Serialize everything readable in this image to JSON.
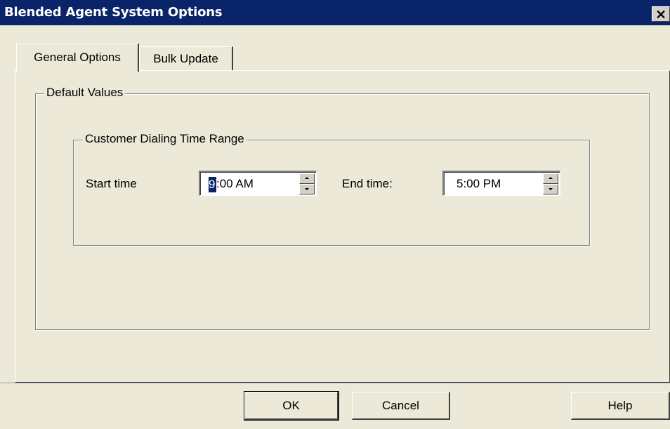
{
  "window": {
    "title": "Blended Agent System Options",
    "close_glyph": "✕"
  },
  "tabs": [
    {
      "label": "General Options",
      "active": true
    },
    {
      "label": "Bulk Update",
      "active": false
    }
  ],
  "default_values": {
    "legend": "Default Values",
    "dialing_range": {
      "legend": "Customer Dialing Time Range",
      "start_label": "Start time",
      "start_caret": "9",
      "start_rest": ":00 AM",
      "end_label": "End time:",
      "end_value": "5:00 PM"
    }
  },
  "buttons": {
    "ok": "OK",
    "cancel": "Cancel",
    "help": "Help"
  },
  "icons": {
    "close": "close-icon",
    "spin_up": "arrow-up-icon",
    "spin_down": "arrow-down-icon"
  },
  "colors": {
    "titlebar": "#0a246a",
    "face": "#ece9d8",
    "selection": "#0a246a"
  }
}
